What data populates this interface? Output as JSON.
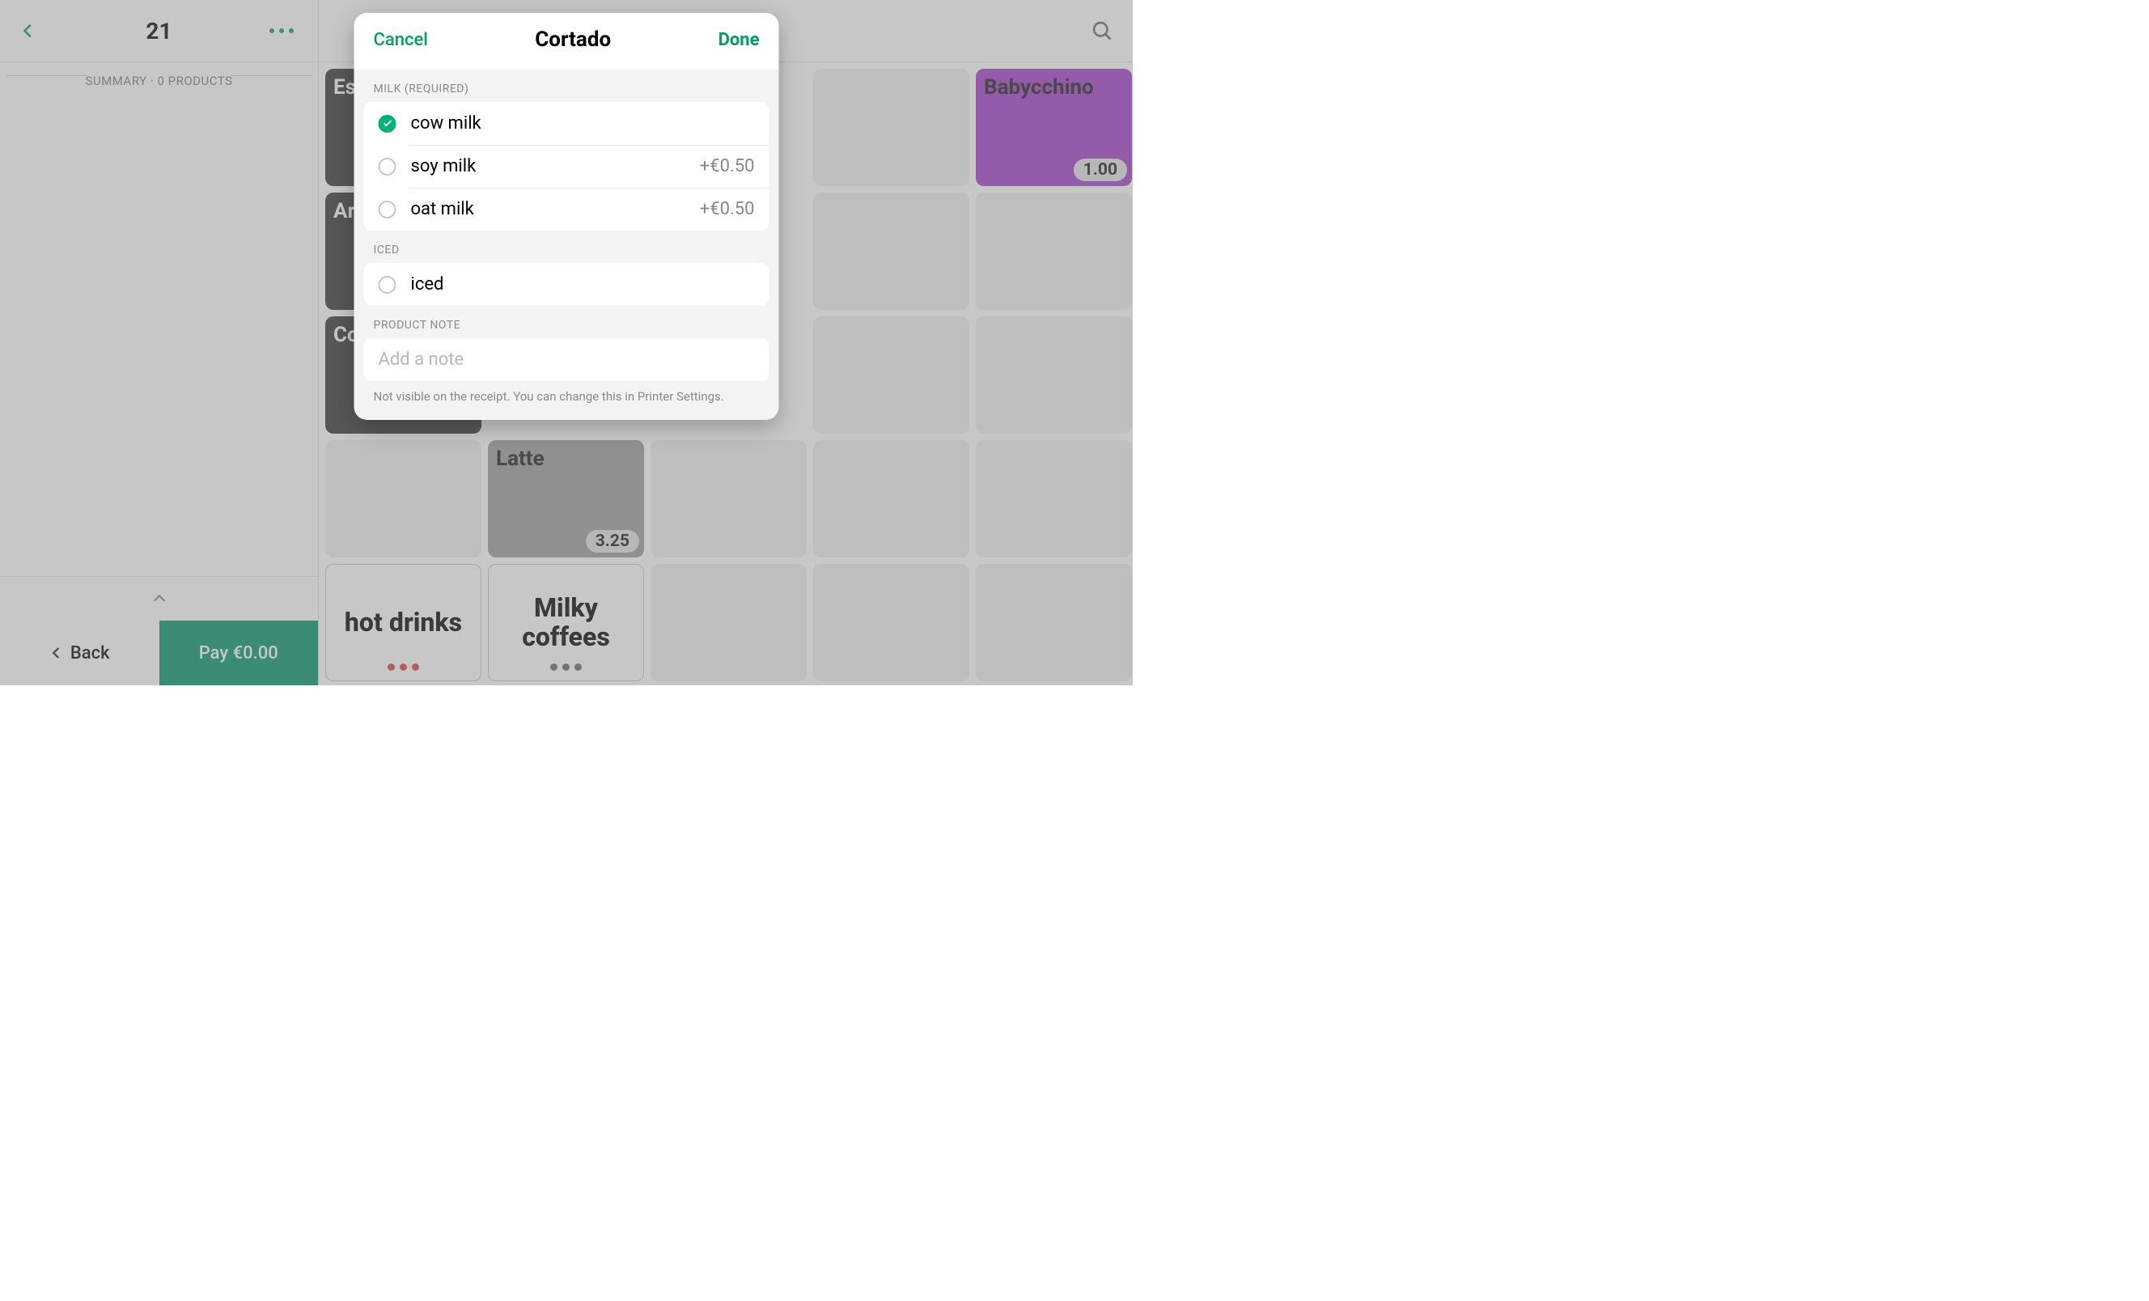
{
  "sidebar": {
    "order_number": "21",
    "summary_line": "SUMMARY · 0 PRODUCTS",
    "back_label": "Back",
    "pay_label": "Pay €0.00"
  },
  "grid": {
    "tiles": [
      {
        "name": "Es",
        "kind": "dark"
      },
      {
        "name": "",
        "kind": "hidden"
      },
      {
        "name": "",
        "kind": "hidden"
      },
      {
        "name": "",
        "kind": "empty"
      },
      {
        "name": "Babycchino",
        "kind": "purple",
        "price": "1.00"
      },
      {
        "name": "Ar",
        "kind": "dark"
      },
      {
        "name": "",
        "kind": "hidden"
      },
      {
        "name": "",
        "kind": "hidden"
      },
      {
        "name": "",
        "kind": "empty"
      },
      {
        "name": "",
        "kind": "empty"
      },
      {
        "name": "Co",
        "kind": "dark"
      },
      {
        "name": "",
        "kind": "hidden"
      },
      {
        "name": "",
        "kind": "hidden"
      },
      {
        "name": "",
        "kind": "empty"
      },
      {
        "name": "",
        "kind": "empty"
      },
      {
        "name": "",
        "kind": "empty"
      },
      {
        "name": "Latte",
        "kind": "grey",
        "price": "3.25"
      },
      {
        "name": "",
        "kind": "empty"
      },
      {
        "name": "",
        "kind": "empty"
      },
      {
        "name": "",
        "kind": "empty"
      },
      {
        "name": "hot drinks",
        "kind": "cat",
        "dot": "red"
      },
      {
        "name": "Milky coffees",
        "kind": "cat",
        "dot": "grey"
      },
      {
        "name": "",
        "kind": "empty"
      },
      {
        "name": "",
        "kind": "empty"
      },
      {
        "name": "",
        "kind": "empty"
      }
    ]
  },
  "modal": {
    "cancel_label": "Cancel",
    "title": "Cortado",
    "done_label": "Done",
    "groups": [
      {
        "label": "MILK (REQUIRED)",
        "options": [
          {
            "label": "cow milk",
            "price": "",
            "selected": true
          },
          {
            "label": "soy milk",
            "price": "+€0.50",
            "selected": false
          },
          {
            "label": "oat milk",
            "price": "+€0.50",
            "selected": false
          }
        ]
      },
      {
        "label": "ICED",
        "options": [
          {
            "label": "iced",
            "price": "",
            "selected": false
          }
        ]
      }
    ],
    "note": {
      "section_label": "PRODUCT NOTE",
      "placeholder": "Add a note",
      "hint": "Not visible on the receipt. You can change this in Printer Settings."
    }
  }
}
